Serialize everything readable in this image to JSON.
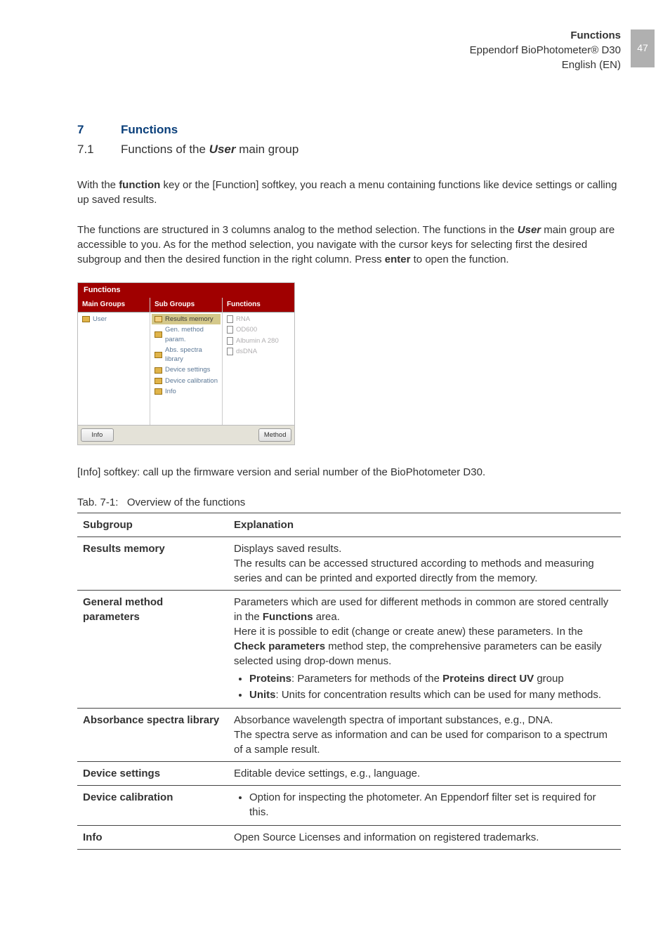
{
  "header": {
    "line1": "Functions",
    "line2": "Eppendorf BioPhotometer® D30",
    "line3": "English (EN)",
    "pageNumber": "47"
  },
  "section": {
    "num": "7",
    "title": "Functions",
    "subNum": "7.1",
    "subTitle_pre": "Functions of the ",
    "subTitle_em": "User",
    "subTitle_post": " main group"
  },
  "para1_pre": "With the ",
  "para1_b1": "function",
  "para1_post": " key or the [Function] softkey, you reach a menu containing functions like device settings or calling up saved results.",
  "para2_pre": "The functions are structured in 3 columns analog to the method selection. The functions in the ",
  "para2_em": "User",
  "para2_mid": " main group are accessible to you. As for the method selection, you navigate with the cursor keys for selecting first the desired subgroup and then the desired function in the right column. Press ",
  "para2_b2": "enter",
  "para2_post": " to open the function.",
  "screen": {
    "title": "Functions",
    "col1": {
      "head": "Main Groups",
      "items": [
        "User"
      ]
    },
    "col2": {
      "head": "Sub Groups",
      "items": [
        "Results memory",
        "Gen. method param.",
        "Abs. spectra library",
        "Device settings",
        "Device calibration",
        "Info"
      ]
    },
    "col3": {
      "head": "Functions",
      "items": [
        "RNA",
        "OD600",
        "Albumin A 280",
        "dsDNA"
      ]
    },
    "softkeys": {
      "left": "Info",
      "right": "Method"
    }
  },
  "para3": "[Info] softkey: call up the firmware version and serial number of the BioPhotometer D30.",
  "tableCaption_pre": "Tab. 7-1:",
  "tableCaption_post": "Overview of the functions",
  "table": {
    "head": {
      "c1": "Subgroup",
      "c2": "Explanation"
    },
    "rows": {
      "r1": {
        "c1": "Results memory",
        "line1": "Displays saved results.",
        "line2": "The results can be accessed structured according to methods and measuring series and can be printed and exported directly from the memory."
      },
      "r2": {
        "c1": "General method parameters",
        "line1_pre": "Parameters which are used for different methods in common are stored centrally in the ",
        "line1_b": "Functions",
        "line1_post": " area.",
        "line2_pre": "Here it is possible to edit (change or create anew) these parameters. In the ",
        "line2_b": "Check parameters",
        "line2_post": " method step, the comprehensive parameters can be easily selected using drop-down menus.",
        "bullet1_b1": "Proteins",
        "bullet1_mid": ": Parameters for methods of the ",
        "bullet1_b2": "Proteins direct UV",
        "bullet1_post": " group",
        "bullet2_b": "Units",
        "bullet2_post": ": Units for concentration results which can be used for many methods."
      },
      "r3": {
        "c1": "Absorbance spectra library",
        "line1": "Absorbance wavelength spectra of important substances, e.g., DNA.",
        "line2": "The spectra serve as information and can be used for comparison to a spectrum of a sample result."
      },
      "r4": {
        "c1": "Device settings",
        "line1": "Editable device settings, e.g., language."
      },
      "r5": {
        "c1": "Device calibration",
        "bullet1": "Option for inspecting the photometer. An Eppendorf filter set is required for this."
      },
      "r6": {
        "c1": "Info",
        "line1": "Open Source Licenses and information on registered trademarks."
      }
    }
  }
}
